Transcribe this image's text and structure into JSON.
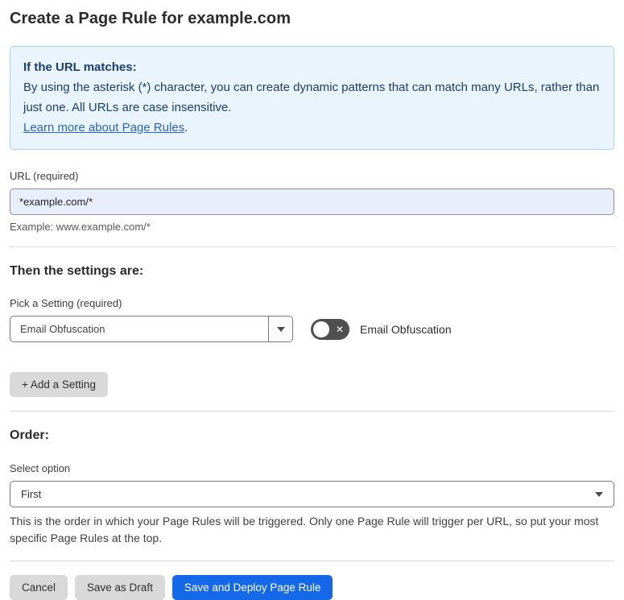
{
  "page": {
    "title": "Create a Page Rule for example.com"
  },
  "info_box": {
    "heading": "If the URL matches:",
    "body": "By using the asterisk (*) character, you can create dynamic patterns that can match many URLs, rather than just one. All URLs are case insensitive.",
    "link_label": "Learn more about Page Rules",
    "link_suffix": "."
  },
  "url_field": {
    "label": "URL (required)",
    "value": "*example.com/*",
    "helper": "Example: www.example.com/*"
  },
  "settings_section": {
    "heading": "Then the settings are:",
    "picker_label": "Pick a Setting (required)",
    "picker_value": "Email Obfuscation",
    "toggle_label": "Email Obfuscation",
    "toggle_state": "off",
    "add_setting_label": "+ Add a Setting"
  },
  "order_section": {
    "heading": "Order:",
    "select_label": "Select option",
    "select_value": "First",
    "helper": "This is the order in which your Page Rules will be triggered. Only one Page Rule will trigger per URL, so put your most specific Page Rules at the top."
  },
  "footer": {
    "cancel_label": "Cancel",
    "save_draft_label": "Save as Draft",
    "save_deploy_label": "Save and Deploy Page Rule"
  },
  "icons": {
    "toggle_x": "✕"
  },
  "colors": {
    "accent_blue": "#1568e8",
    "info_bg": "#e9f4fd",
    "info_border": "#abd3ef",
    "info_text": "#1d3d6f",
    "link_blue": "#2b63c9",
    "input_bg": "#e8eefb",
    "toggle_bg": "#4f4f4f",
    "button_gray": "#d9d9d9"
  }
}
